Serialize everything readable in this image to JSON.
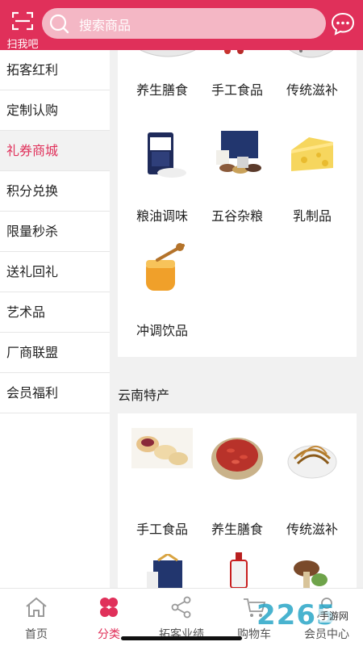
{
  "header": {
    "scan_label": "扫我吧",
    "search_placeholder": "搜索商品"
  },
  "colors": {
    "brand": "#e0305a",
    "search_bg": "#f4b7c5"
  },
  "sidebar": {
    "items": [
      {
        "label": "拓客红利"
      },
      {
        "label": "定制认购"
      },
      {
        "label": "礼券商城",
        "active": true
      },
      {
        "label": "积分兑换"
      },
      {
        "label": "限量秒杀"
      },
      {
        "label": "送礼回礼"
      },
      {
        "label": "艺术品"
      },
      {
        "label": "厂商联盟"
      },
      {
        "label": "会员福利"
      }
    ]
  },
  "main": {
    "top_grid": [
      {
        "label": "养生膳食",
        "icon": "food-bowl-icon"
      },
      {
        "label": "手工食品",
        "icon": "handmade-food-icon"
      },
      {
        "label": "传统滋补",
        "icon": "tonic-icon"
      },
      {
        "label": "粮油调味",
        "icon": "rice-bag-icon"
      },
      {
        "label": "五谷杂粮",
        "icon": "grain-giftbox-icon"
      },
      {
        "label": "乳制品",
        "icon": "cheese-icon"
      },
      {
        "label": "冲调饮品",
        "icon": "honey-jar-icon"
      }
    ],
    "section_title": "云南特产",
    "bottom_grid": [
      {
        "label": "手工食品",
        "icon": "flower-cake-icon"
      },
      {
        "label": "养生膳食",
        "icon": "goji-bowl-icon"
      },
      {
        "label": "传统滋补",
        "icon": "cordyceps-icon"
      },
      {
        "label": "",
        "icon": "giftbox-icon"
      },
      {
        "label": "",
        "icon": "liquor-bottle-icon"
      },
      {
        "label": "",
        "icon": "mushroom-icon"
      }
    ]
  },
  "tabbar": {
    "tabs": [
      {
        "label": "首页",
        "icon": "home-icon"
      },
      {
        "label": "分类",
        "icon": "category-icon",
        "active": true
      },
      {
        "label": "拓客业绩",
        "icon": "share-icon"
      },
      {
        "label": "购物车",
        "icon": "cart-icon"
      },
      {
        "label": "会员中心",
        "icon": "user-icon"
      }
    ]
  },
  "watermark": {
    "text": "2265",
    "sub": "手游网"
  }
}
